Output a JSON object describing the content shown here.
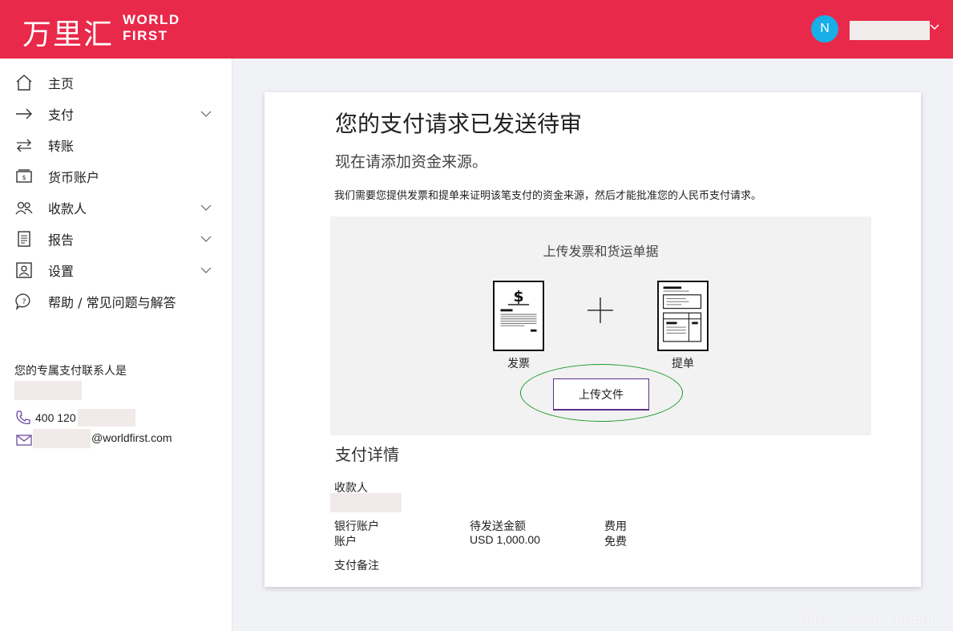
{
  "header": {
    "logo_cn": "万里汇",
    "logo_en_line1": "WORLD",
    "logo_en_line2": "FIRST",
    "avatar_initial": "N",
    "brand_color": "#e8294a"
  },
  "sidebar": {
    "items": [
      {
        "label": "主页",
        "icon": "home-icon"
      },
      {
        "label": "支付",
        "icon": "arrow-right-icon",
        "expandable": true
      },
      {
        "label": "转账",
        "icon": "transfer-icon"
      },
      {
        "label": "货币账户",
        "icon": "wallet-icon"
      },
      {
        "label": "收款人",
        "icon": "users-icon",
        "expandable": true
      },
      {
        "label": "报告",
        "icon": "report-icon",
        "expandable": true
      },
      {
        "label": "设置",
        "icon": "settings-icon",
        "expandable": true
      },
      {
        "label": "帮助 / 常见问题与解答",
        "icon": "help-icon"
      }
    ],
    "contact": {
      "title": "您的专属支付联系人是",
      "phone_prefix": "400 120",
      "email_suffix": "@worldfirst.com"
    }
  },
  "main": {
    "title": "您的支付请求已发送待审",
    "subtitle": "现在请添加资金来源。",
    "description": "我们需要您提供发票和提单来证明该笔支付的资金来源，然后才能批准您的人民币支付请求。",
    "upload": {
      "title": "上传发票和货运单据",
      "invoice_label": "发票",
      "bill_label": "提单",
      "button_label": "上传文件"
    },
    "details": {
      "title": "支付详情",
      "payee_label": "收款人",
      "bank_account_label": "银行账户",
      "account_label": "账户",
      "amount_label": "待发送金额",
      "amount_value": "USD 1,000.00",
      "fee_label": "费用",
      "fee_value": "免费",
      "note_label": "支付备注"
    }
  },
  "watermark": "https://wf.tao.cheap"
}
